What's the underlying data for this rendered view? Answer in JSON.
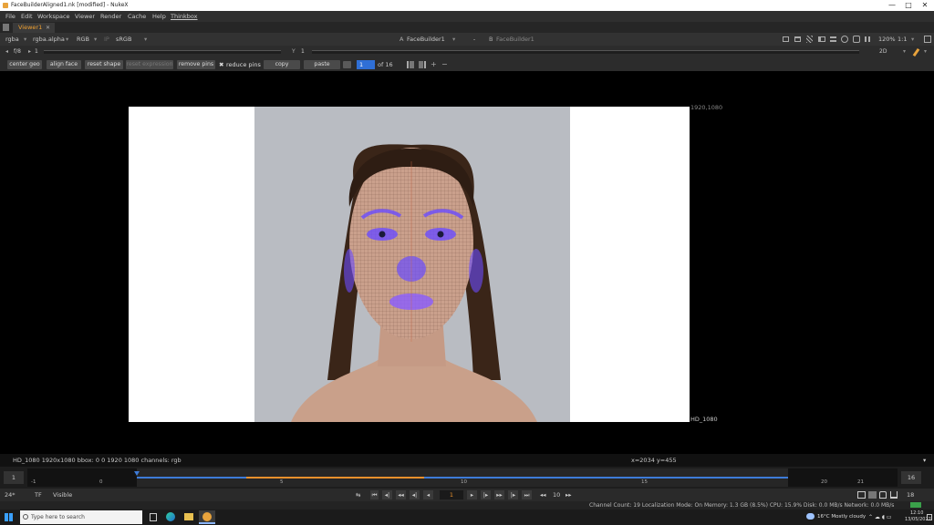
{
  "window": {
    "title": "FaceBuilderAligned1.nk [modified] - NukeX",
    "controls": [
      "—",
      "□",
      "✕"
    ]
  },
  "menu": [
    "File",
    "Edit",
    "Workspace",
    "Viewer",
    "Render",
    "Cache",
    "Help",
    "Thinkbox"
  ],
  "tab": {
    "label": "Viewer1",
    "close": "✕"
  },
  "toolbar1": {
    "channels": "rgba",
    "alpha": "rgba.alpha",
    "display": "RGB",
    "ip": "IP",
    "colorspace": "sRGB",
    "input_a_label": "A",
    "input_a": "FaceBuilder1",
    "separator": "-",
    "input_b_label": "B",
    "input_b": "FaceBuilder1",
    "zoom": "120%",
    "ratio": "1:1"
  },
  "toolbar2": {
    "fstop": "f/8",
    "gain": "1",
    "y_label": "Y",
    "y_value": "1",
    "view_mode": "2D"
  },
  "toolbar3": {
    "center_geo": "center geo",
    "align_face": "align face",
    "reset_shape": "reset shape",
    "reset_expression": "reset expression",
    "remove_pins": "remove pins",
    "reduce_pins": "reduce pins",
    "copy": "copy",
    "paste": "paste",
    "frame_value": "1",
    "frame_of": "of 16"
  },
  "viewer": {
    "format_top": "1920,1080",
    "format_bottom": "HD_1080"
  },
  "infobar": {
    "info": "HD_1080 1920x1080  bbox: 0 0 1920 1080 channels: rgb",
    "coords": "x=2034 y=455"
  },
  "timeline": {
    "start": "1",
    "end": "16",
    "ticks": [
      "-1",
      "0",
      "5",
      "10",
      "15",
      "20",
      "21"
    ]
  },
  "playbar": {
    "fps": "24*",
    "tf": "TF",
    "visible": "Visible",
    "frame": "1",
    "step": "10",
    "end_frame": "18"
  },
  "status": {
    "text": "Channel Count: 19  Localization Mode: On  Memory: 1.3 GB (8.5%)  CPU: 15.9%  Disk: 0.0 MB/s  Network: 0.0 MB/s"
  },
  "taskbar": {
    "search": "Type here to search",
    "weather": "16°C  Mostly cloudy",
    "time": "12:10",
    "date": "13/05/2022"
  },
  "colors": {
    "accent": "#f0a030",
    "pins": "#7a5cff",
    "selection": "#2f6fd6"
  }
}
